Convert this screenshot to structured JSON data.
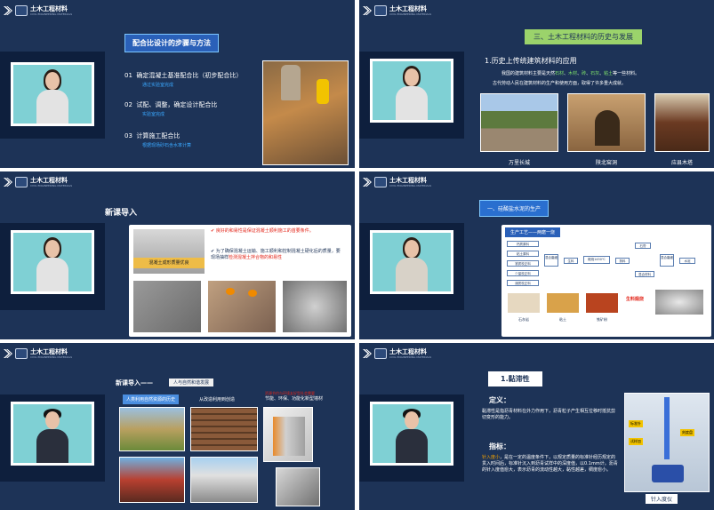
{
  "logo": {
    "name": "土木工程材料",
    "en": "CIVIL ENGINEERING MATERIALS"
  },
  "slide1": {
    "title": "配合比设计的步骤与方法",
    "steps": [
      {
        "num": "01",
        "text": "确定混凝土基准配合比（初步配合比）",
        "sub": "通过实验室完成"
      },
      {
        "num": "02",
        "text": "试配、调整，确定设计配合比",
        "sub": "实验室完成"
      },
      {
        "num": "03",
        "text": "计算施工配合比",
        "sub": "根据现场砂石含水率计算"
      }
    ]
  },
  "slide2": {
    "section": "三、土木工程材料的历史与发展",
    "heading": "1.历史上传统建筑材料的应用",
    "para_prefix": "我国的建筑材料主要是天然",
    "materials": [
      "石材",
      "木材",
      "砖",
      "石灰",
      "粘土"
    ],
    "para_suffix": "等一些材料。",
    "para2": "古代劳动人民在建筑材料的生产和使用方面，取得了许多重大成就。",
    "captions": [
      "万里长城",
      "陕北窑洞",
      "应县木塔"
    ]
  },
  "slide3": {
    "title": "新课导入",
    "bullet1_a": "良好的和易性是保证混凝土顺利施工的首要条件。",
    "bullet2_a": "为了确保混凝土运输、施工顺利和控制混凝土硬化后的质量，要现场抽样",
    "bullet2_b": "检测混凝土拌合物的和易性",
    "photo_label": "混凝土成形质量优良"
  },
  "slide4": {
    "section": "一、硅酸盐水泥的生产",
    "diagram_title": "生产工艺——两磨一烧",
    "inputs": [
      "钙质原料",
      "粘土原料",
      "铁质校正料",
      "少量校正料",
      "煤质校正料"
    ],
    "steps": [
      "混合磨细",
      "生料",
      "煅烧1450℃",
      "熟料",
      "混合磨细",
      "水泥"
    ],
    "additives": [
      "石膏",
      "混合材料"
    ],
    "label_raw": "生料煅烧",
    "photo_captions": [
      "石灰岩",
      "粘土",
      "铁矿粉"
    ]
  },
  "slide5": {
    "title": "新课导入——",
    "tag": "人与自然和谐发展",
    "label1": "人类利用自然资源的历史",
    "label2": "从改造利用到创造",
    "label3": "资源节约与环境友好型社会需要",
    "label3_sub": "节能、环保、功能化新型墙材"
  },
  "slide6": {
    "title": "1.黏滞性",
    "def_label": "定义：",
    "def_text": "黏滞性是指沥青材料在外力作用下，沥青粒子产生相互位移时抵抗剪切变形的能力。",
    "index_label": "指标：",
    "index_highlight": "针入度小",
    "index_text": "，是在一定的温度条件下，以规定质量的标准针经历规定的贯入时间后，标准针沉入到沥青试样中的深度值，以0.1mm计。沥青的针入度值愈大，表示沥青的流动性越大，黏性越差，稠度愈小。",
    "device_caption": "针入度仪",
    "device_labels": [
      "标准针",
      "试样皿",
      "刻度盘"
    ]
  }
}
